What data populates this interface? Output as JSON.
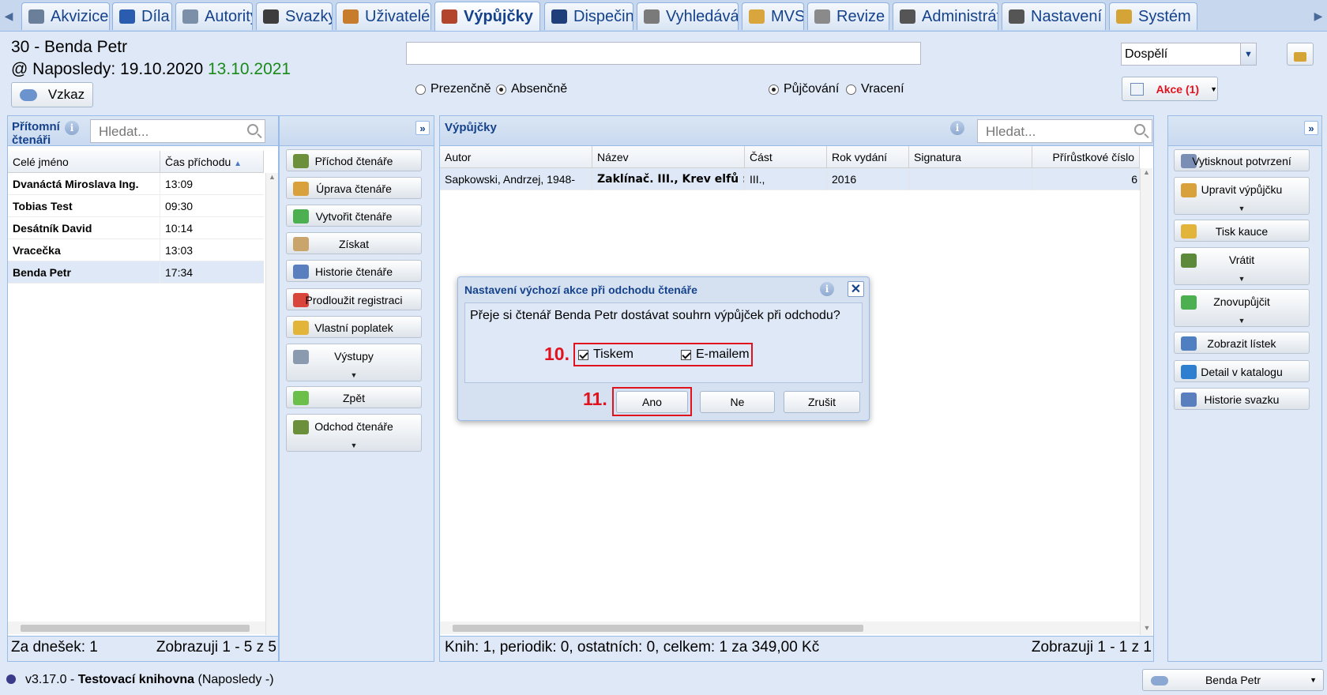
{
  "nav": {
    "tabs": [
      {
        "label": "Akvizice",
        "icon": "cart-icon"
      },
      {
        "label": "Díla",
        "icon": "book-icon"
      },
      {
        "label": "Autority",
        "icon": "card-icon"
      },
      {
        "label": "Svazky",
        "icon": "pen-icon"
      },
      {
        "label": "Uživatelé",
        "icon": "users-icon"
      },
      {
        "label": "Výpůjčky",
        "icon": "books-icon",
        "active": true
      },
      {
        "label": "Dispečink",
        "icon": "monitor-icon"
      },
      {
        "label": "Vyhledávání",
        "icon": "search-icon"
      },
      {
        "label": "MVS",
        "icon": "package-icon"
      },
      {
        "label": "Revize",
        "icon": "document-icon"
      },
      {
        "label": "Administrátor REKSu",
        "icon": "tools-icon"
      },
      {
        "label": "Nastavení",
        "icon": "settings-icon"
      },
      {
        "label": "Systém",
        "icon": "key-icon"
      }
    ]
  },
  "reader": {
    "title": "30 - Benda Petr",
    "last_visit_prefix": "@ Naposledy: 19.10.2020",
    "last_visit_green": "13.10.2021",
    "message_button": "Vzkaz"
  },
  "controls": {
    "top_input_value": "",
    "category_select": "Dospělí",
    "radio_presence": "Prezenčně",
    "radio_absence": "Absenčně",
    "radio_lending": "Půjčování",
    "radio_returning": "Vracení",
    "actions_button": "Akce (1)",
    "colors": {
      "accent": "#15428b",
      "alert": "#e0121e",
      "green": "#1a8a1a"
    }
  },
  "present_readers": {
    "title_line1": "Přítomní",
    "title_line2": "čtenáři",
    "search_placeholder": "Hledat...",
    "columns": [
      "Celé jméno",
      "Čas příchodu"
    ],
    "rows": [
      {
        "name": "Dvanáctá Miroslava Ing.",
        "time": "13:09"
      },
      {
        "name": "Tobias Test",
        "time": "09:30"
      },
      {
        "name": "Desátník David",
        "time": "10:14"
      },
      {
        "name": "Vracečka",
        "time": "13:03"
      },
      {
        "name": "Benda Petr",
        "time": "17:34"
      }
    ],
    "footer_left": "Za dnešek: 1",
    "footer_right": "Zobrazuji 1 - 5 z 5"
  },
  "reader_actions": [
    {
      "label": "Příchod čtenáře",
      "icon": "door-enter-icon"
    },
    {
      "label": "Úprava čtenáře",
      "icon": "pencil-icon"
    },
    {
      "label": "Vytvořit čtenáře",
      "icon": "add-icon"
    },
    {
      "label": "Získat",
      "icon": "hourglass-icon"
    },
    {
      "label": "Historie čtenáře",
      "icon": "info-icon"
    },
    {
      "label": "Prodloužit registraci",
      "icon": "calendar-icon"
    },
    {
      "label": "Vlastní poplatek",
      "icon": "coins-icon"
    },
    {
      "label": "Výstupy",
      "icon": "printer-icon",
      "dropdown": true
    },
    {
      "label": "Zpět",
      "icon": "arrow-left-icon"
    },
    {
      "label": "Odchod čtenáře",
      "icon": "door-exit-icon",
      "dropdown": true
    }
  ],
  "loans": {
    "title": "Výpůjčky",
    "search_placeholder": "Hledat...",
    "columns": [
      "Autor",
      "Název",
      "Část",
      "Rok vydání",
      "Signatura",
      "Přírůstkové číslo"
    ],
    "rows": [
      {
        "author": "Sapkowski, Andrzej, 1948-",
        "name": "Zaklínač. III., Krev elfů : ...",
        "part": "III.,",
        "year": "2016",
        "signature": "",
        "accession": "6"
      }
    ],
    "footer_left": "Knih: 1, periodik: 0, ostatních: 0, celkem: 1 za 349,00 Kč",
    "footer_right": "Zobrazuji 1 - 1 z 1"
  },
  "loan_actions": [
    {
      "label": "Vytisknout potvrzení",
      "icon": "print-confirm-icon"
    },
    {
      "label": "Upravit výpůjčku",
      "icon": "edit-loan-icon",
      "dropdown": true
    },
    {
      "label": "Tisk kauce",
      "icon": "coins-icon"
    },
    {
      "label": "Vrátit",
      "icon": "return-icon",
      "dropdown": true
    },
    {
      "label": "Znovupůjčit",
      "icon": "renew-icon",
      "dropdown": true
    },
    {
      "label": "Zobrazit lístek",
      "icon": "ticket-icon"
    },
    {
      "label": "Detail v katalogu",
      "icon": "globe-icon"
    },
    {
      "label": "Historie svazku",
      "icon": "info-icon"
    }
  ],
  "dialog": {
    "title": "Nastavení výchozí akce při odchodu čtenáře",
    "question": "Přeje si čtenář Benda Petr dostávat souhrn výpůjček při odchodu?",
    "check_print": "Tiskem",
    "check_email": "E-mailem",
    "btn_yes": "Ano",
    "btn_no": "Ne",
    "btn_cancel": "Zrušit",
    "marker_10": "10.",
    "marker_11": "11."
  },
  "statusbar": {
    "version": "v3.17.0 -",
    "library": "Testovací knihovna",
    "last": "(Naposledy -)",
    "user": "Benda Petr"
  }
}
